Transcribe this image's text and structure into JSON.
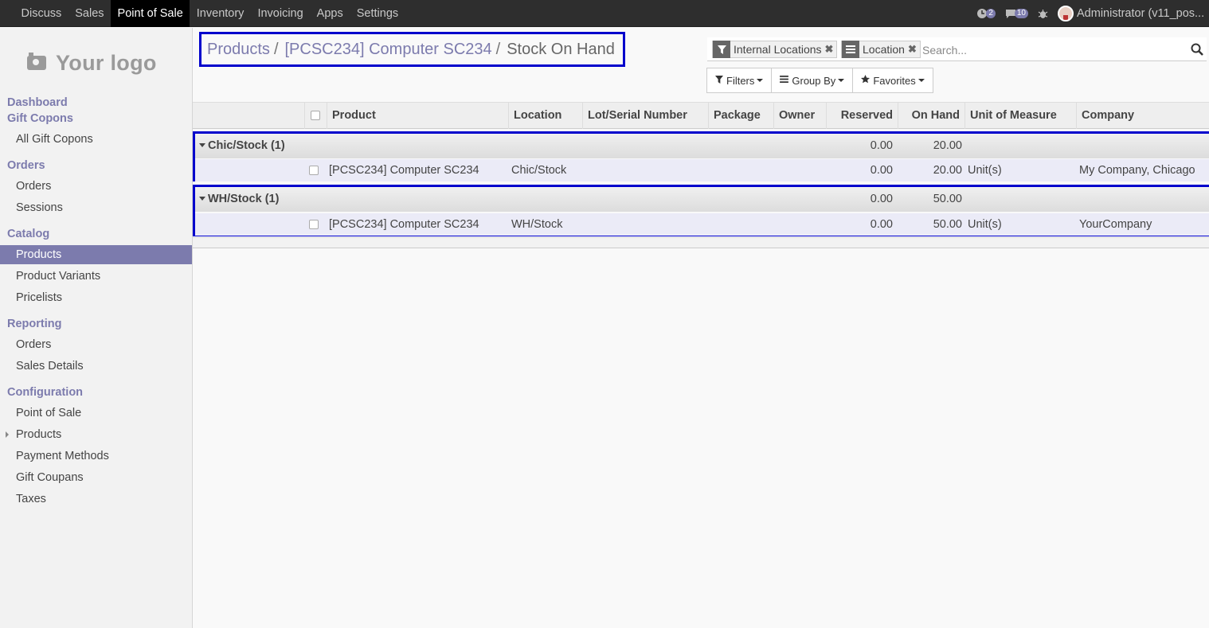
{
  "topbar": {
    "apps": [
      "Discuss",
      "Sales",
      "Point of Sale",
      "Inventory",
      "Invoicing",
      "Apps",
      "Settings"
    ],
    "active_app": "Point of Sale",
    "activity_count": "2",
    "message_count": "10",
    "user": "Administrator (v11_pos..."
  },
  "sidebar": {
    "logo_text": "Your logo",
    "dashboard": "Dashboard",
    "gift_copons_header": "Gift Copons",
    "all_gift_copons": "All Gift Copons",
    "orders_header": "Orders",
    "orders": "Orders",
    "sessions": "Sessions",
    "catalog_header": "Catalog",
    "products": "Products",
    "product_variants": "Product Variants",
    "pricelists": "Pricelists",
    "reporting_header": "Reporting",
    "reporting_orders": "Orders",
    "sales_details": "Sales Details",
    "configuration_header": "Configuration",
    "point_of_sale": "Point of Sale",
    "config_products": "Products",
    "payment_methods": "Payment Methods",
    "gift_coupans": "Gift Coupans",
    "taxes": "Taxes"
  },
  "breadcrumb": {
    "item1": "Products",
    "item2": "[PCSC234] Computer SC234",
    "current": "Stock On Hand",
    "separator": "/"
  },
  "search": {
    "facet1": "Internal Locations",
    "facet2": "Location",
    "placeholder": "Search..."
  },
  "buttons": {
    "filters": "Filters",
    "group_by": "Group By",
    "favorites": "Favorites"
  },
  "table": {
    "columns": {
      "product": "Product",
      "location": "Location",
      "lot": "Lot/Serial Number",
      "package": "Package",
      "owner": "Owner",
      "reserved": "Reserved",
      "on_hand": "On Hand",
      "uom": "Unit of Measure",
      "company": "Company"
    },
    "groups": [
      {
        "name": "Chic/Stock (1)",
        "reserved": "0.00",
        "on_hand": "20.00",
        "row": {
          "product": "[PCSC234] Computer SC234",
          "location": "Chic/Stock",
          "reserved": "0.00",
          "on_hand": "20.00",
          "uom": "Unit(s)",
          "company": "My Company, Chicago"
        }
      },
      {
        "name": "WH/Stock (1)",
        "reserved": "0.00",
        "on_hand": "50.00",
        "row": {
          "product": "[PCSC234] Computer SC234",
          "location": "WH/Stock",
          "reserved": "0.00",
          "on_hand": "50.00",
          "uom": "Unit(s)",
          "company": "YourCompany"
        }
      }
    ]
  },
  "colors": {
    "accent": "#7c7bad",
    "highlight_border": "#0000cc",
    "navbar": "#2e2e2e"
  }
}
